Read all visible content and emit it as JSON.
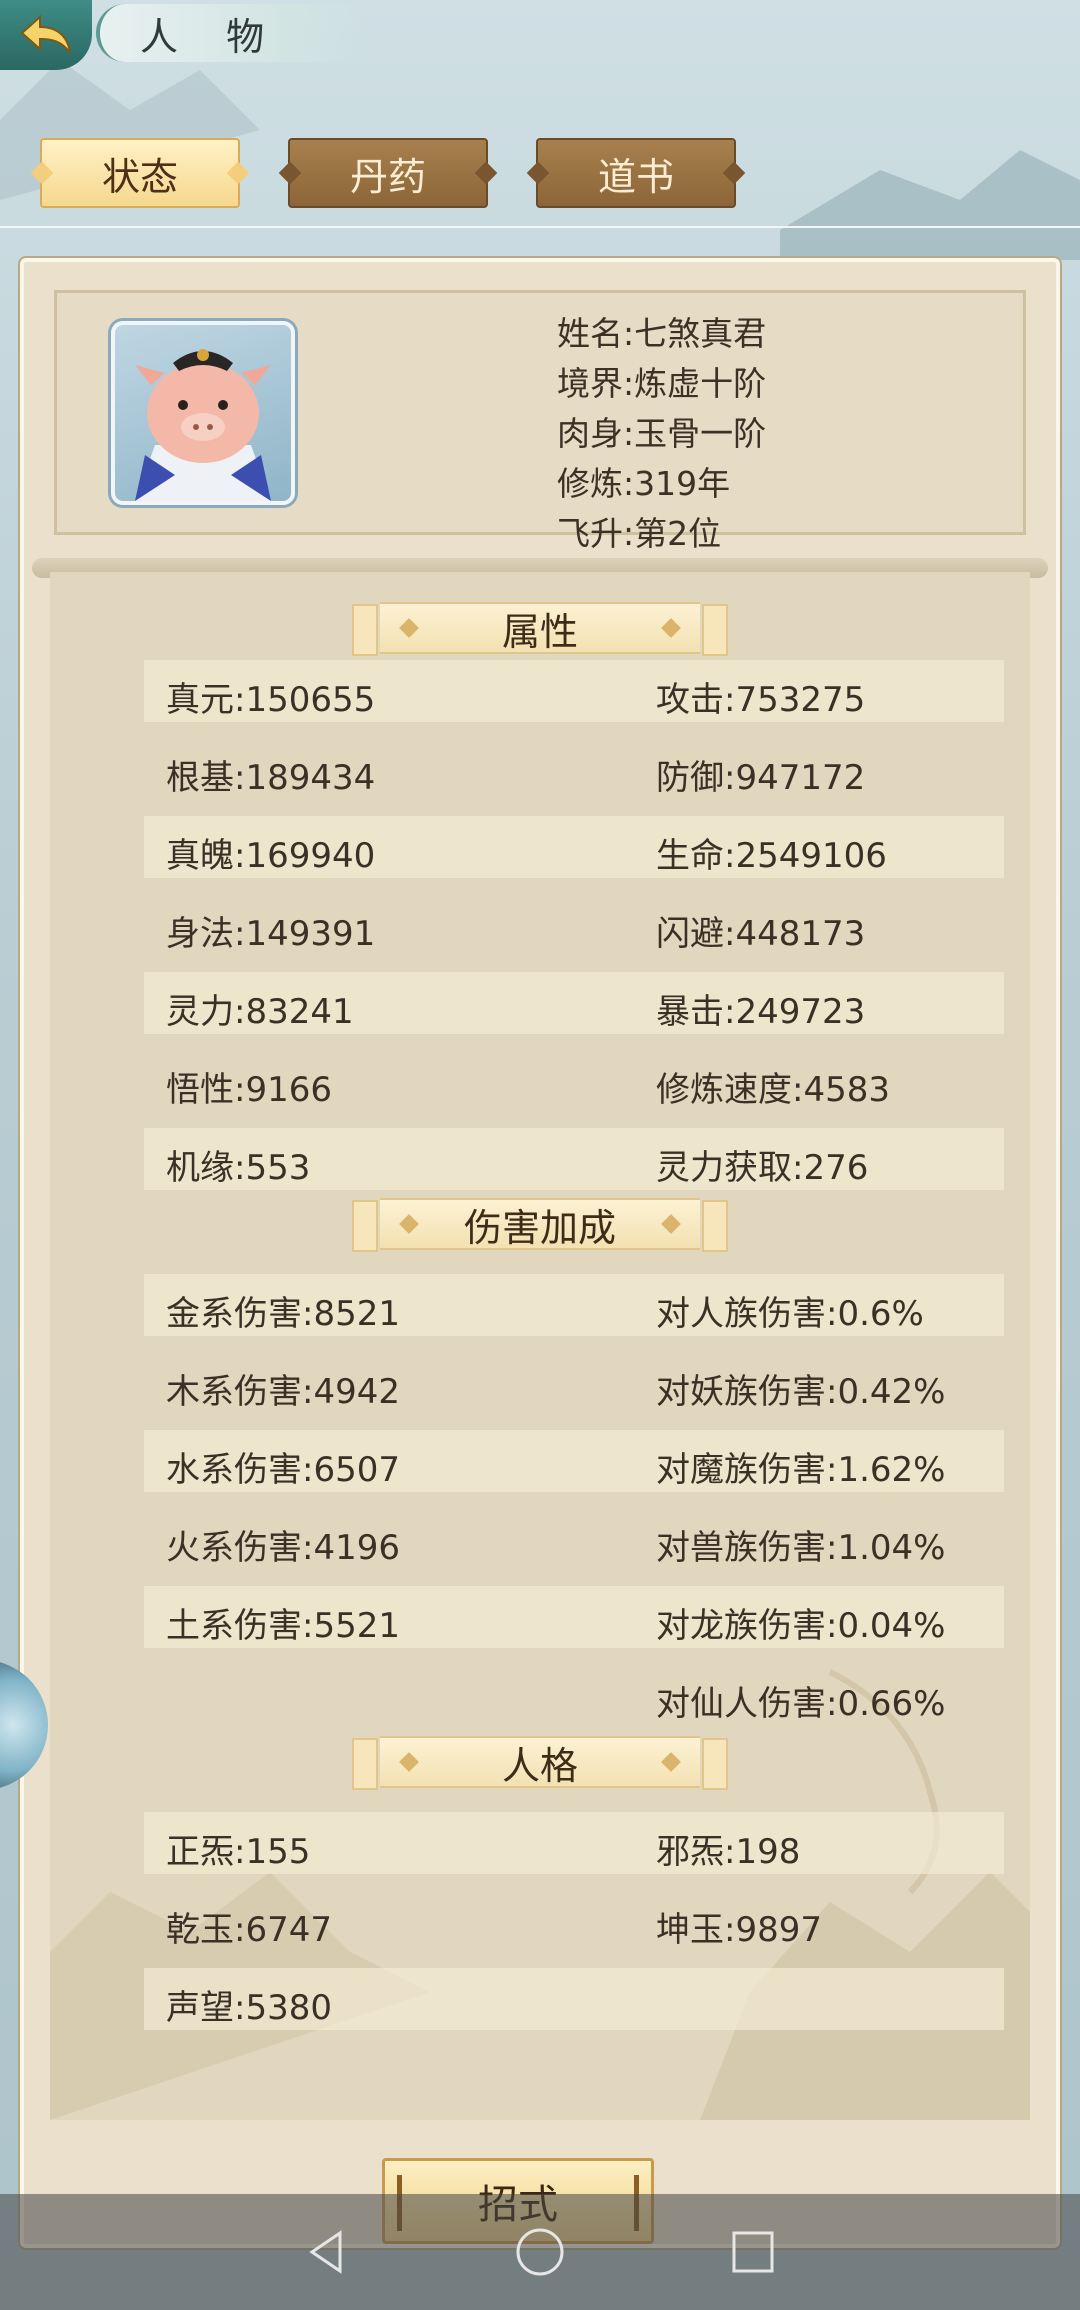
{
  "header": {
    "title": "人 物"
  },
  "tabs": [
    {
      "label": "状态",
      "active": true
    },
    {
      "label": "丹药",
      "active": false
    },
    {
      "label": "道书",
      "active": false
    }
  ],
  "profile": {
    "name": "姓名:七煞真君",
    "realm": "境界:炼虚十阶",
    "body": "肉身:玉骨一阶",
    "cultivation": "修炼:319年",
    "ascension": "飞升:第2位"
  },
  "sections": {
    "attributes": "属性",
    "damage": "伤害加成",
    "personality": "人格"
  },
  "attributes": [
    {
      "left": "真元:150655",
      "right": "攻击:753275"
    },
    {
      "left": "根基:189434",
      "right": "防御:947172"
    },
    {
      "left": "真魄:169940",
      "right": "生命:2549106"
    },
    {
      "left": "身法:149391",
      "right": "闪避:448173"
    },
    {
      "left": "灵力:83241",
      "right": "暴击:249723"
    },
    {
      "left": "悟性:9166",
      "right": "修炼速度:4583"
    },
    {
      "left": "机缘:553",
      "right": "灵力获取:276"
    }
  ],
  "damage": [
    {
      "left": "金系伤害:8521",
      "right": "对人族伤害:0.6%"
    },
    {
      "left": "木系伤害:4942",
      "right": "对妖族伤害:0.42%"
    },
    {
      "left": "水系伤害:6507",
      "right": "对魔族伤害:1.62%"
    },
    {
      "left": "火系伤害:4196",
      "right": "对兽族伤害:1.04%"
    },
    {
      "left": "土系伤害:5521",
      "right": "对龙族伤害:0.04%"
    },
    {
      "left": "",
      "right": "对仙人伤害:0.66%"
    }
  ],
  "personality": [
    {
      "left": "正炁:155",
      "right": "邪炁:198"
    },
    {
      "left": "乾玉:6747",
      "right": "坤玉:9897"
    },
    {
      "left": "声望:5380",
      "right": ""
    }
  ],
  "skill_button": "招式"
}
